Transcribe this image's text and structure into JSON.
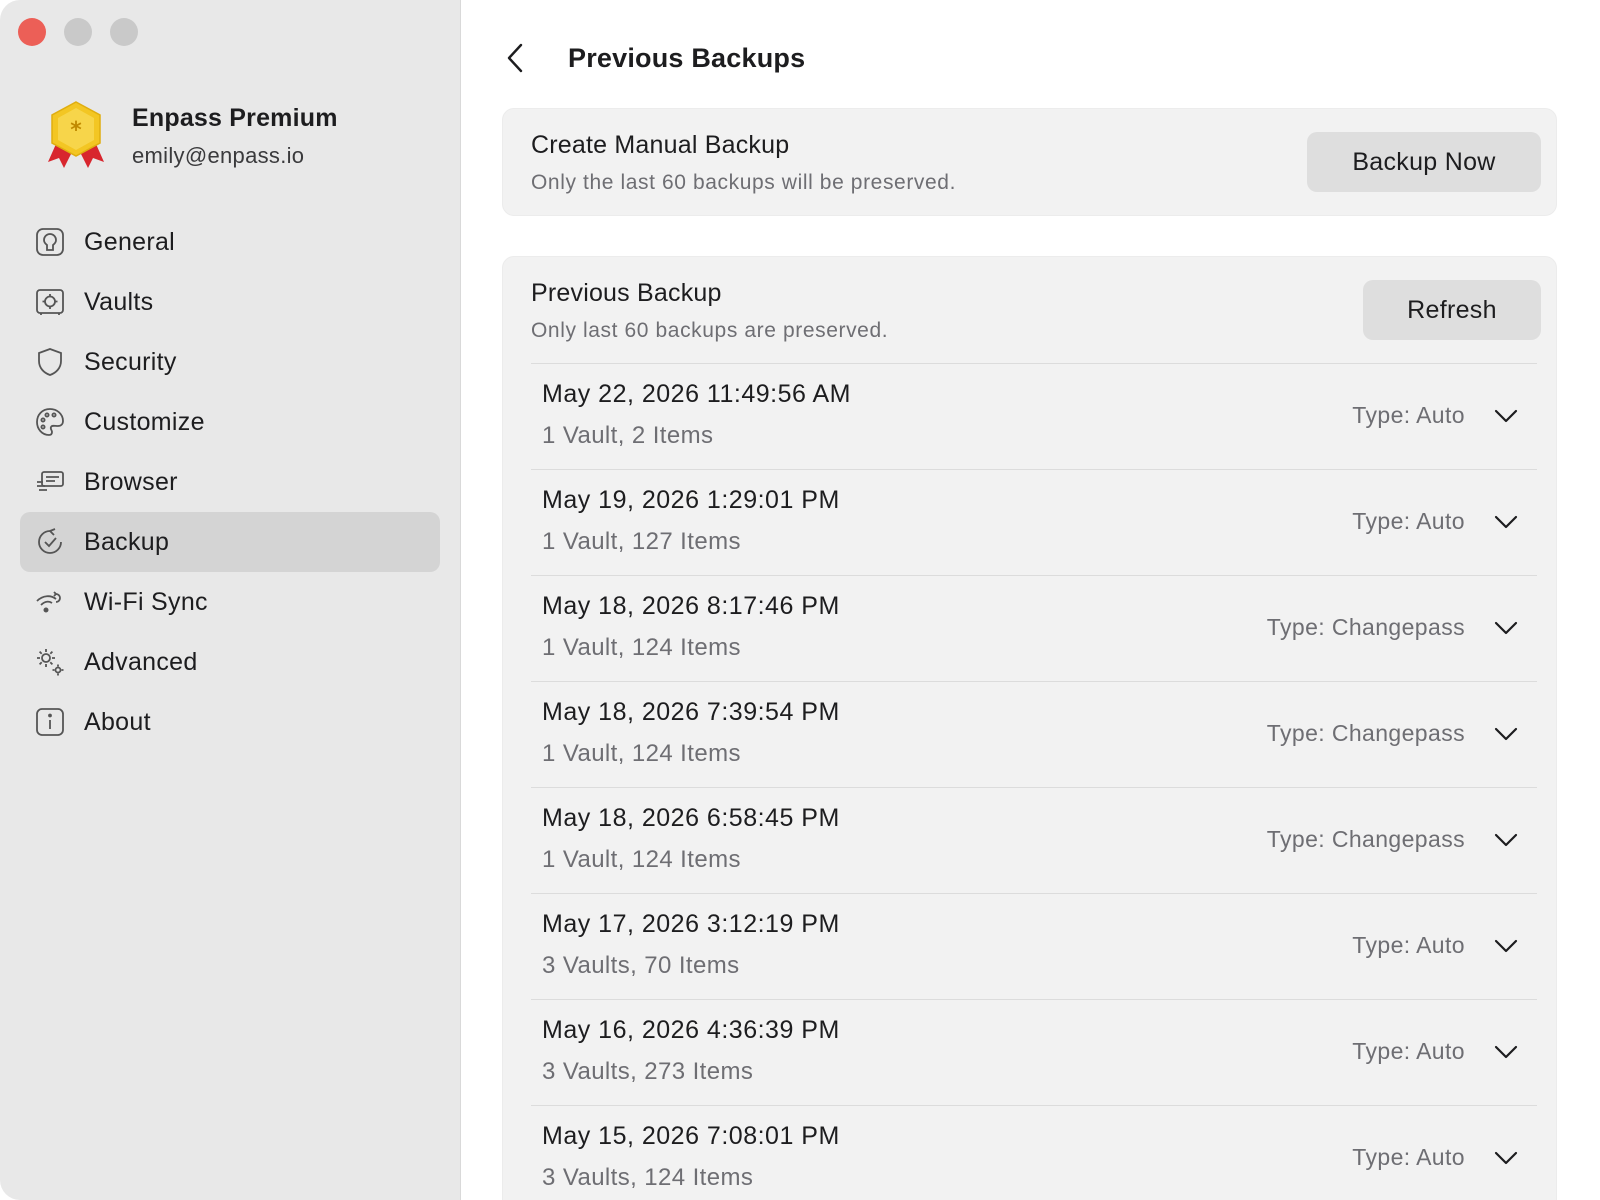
{
  "window": {
    "traffic_lights": [
      "close",
      "minimize",
      "maximize"
    ]
  },
  "profile": {
    "name": "Enpass Premium",
    "email": "emily@enpass.io",
    "badge_icon": "premium-badge-icon"
  },
  "sidebar": {
    "items": [
      {
        "label": "General",
        "icon": "general-icon"
      },
      {
        "label": "Vaults",
        "icon": "vault-icon"
      },
      {
        "label": "Security",
        "icon": "shield-icon"
      },
      {
        "label": "Customize",
        "icon": "palette-icon"
      },
      {
        "label": "Browser",
        "icon": "browser-icon"
      },
      {
        "label": "Backup",
        "icon": "backup-icon",
        "active": true
      },
      {
        "label": "Wi-Fi Sync",
        "icon": "wifi-sync-icon"
      },
      {
        "label": "Advanced",
        "icon": "gears-icon"
      },
      {
        "label": "About",
        "icon": "info-icon"
      }
    ]
  },
  "header": {
    "title": "Previous Backups",
    "back_icon": "chevron-left-icon"
  },
  "manual_backup": {
    "title": "Create Manual Backup",
    "subtitle": "Only the last 60 backups will be preserved.",
    "button_label": "Backup Now"
  },
  "previous_backup": {
    "title": "Previous Backup",
    "subtitle": "Only last 60 backups are preserved.",
    "refresh_label": "Refresh",
    "rows": [
      {
        "date": "May 22, 2026 11:49:56 AM",
        "count": "1 Vault, 2 Items",
        "type": "Type: Auto"
      },
      {
        "date": "May 19, 2026 1:29:01 PM",
        "count": "1 Vault, 127 Items",
        "type": "Type: Auto"
      },
      {
        "date": "May 18, 2026 8:17:46 PM",
        "count": "1 Vault, 124 Items",
        "type": "Type: Changepass"
      },
      {
        "date": "May 18, 2026 7:39:54 PM",
        "count": "1 Vault, 124 Items",
        "type": "Type: Changepass"
      },
      {
        "date": "May 18, 2026 6:58:45 PM",
        "count": "1 Vault, 124 Items",
        "type": "Type: Changepass"
      },
      {
        "date": "May 17, 2026 3:12:19 PM",
        "count": "3 Vaults, 70 Items",
        "type": "Type: Auto"
      },
      {
        "date": "May 16, 2026 4:36:39 PM",
        "count": "3 Vaults, 273 Items",
        "type": "Type: Auto"
      },
      {
        "date": "May 15, 2026 7:08:01 PM",
        "count": "3 Vaults, 124 Items",
        "type": "Type: Auto"
      }
    ]
  },
  "colors": {
    "close": "#ec5f57",
    "sidebar_bg": "#e8e8e8",
    "sidebar_active": "#d4d4d4",
    "card_bg": "#f2f2f2",
    "button_bg": "#dedede",
    "badge_gold": "#f3c623",
    "badge_red": "#d8262e"
  }
}
